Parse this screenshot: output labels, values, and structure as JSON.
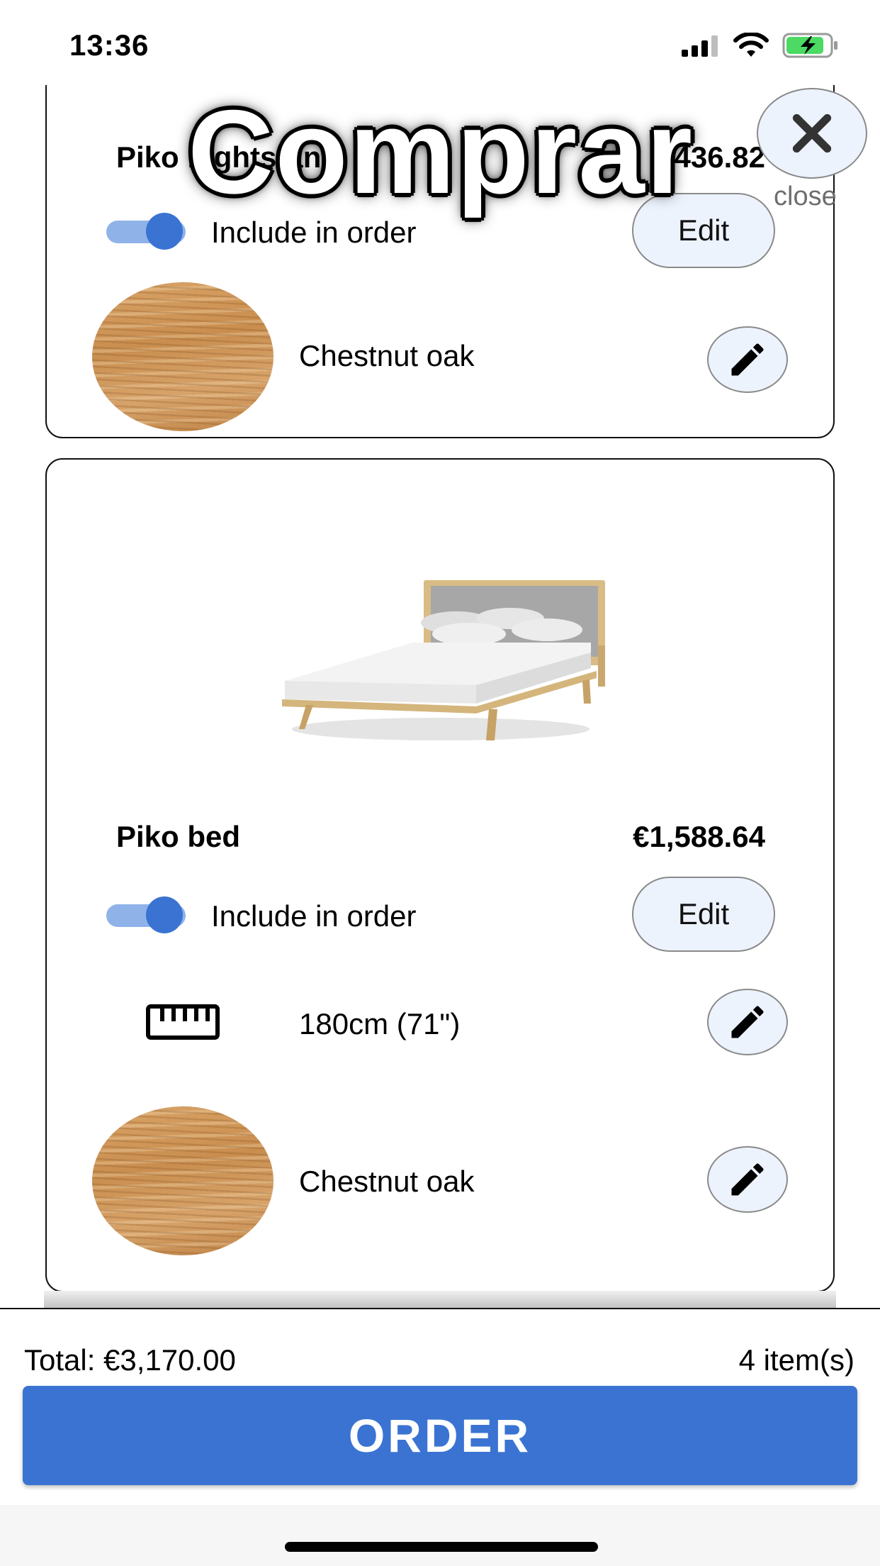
{
  "status_bar": {
    "time": "13:36"
  },
  "overlay": {
    "title": "Comprar",
    "close_label": "close"
  },
  "items": [
    {
      "name": "Piko nightstand",
      "price": "€436.82",
      "include_label": "Include in order",
      "include_checked": true,
      "edit_label": "Edit",
      "options": [
        {
          "type": "material",
          "icon": "wood-swatch",
          "label": "Chestnut oak"
        }
      ]
    },
    {
      "name": "Piko bed",
      "price": "€1,588.64",
      "include_label": "Include in order",
      "include_checked": true,
      "edit_label": "Edit",
      "image": "bed-image",
      "options": [
        {
          "type": "size",
          "icon": "ruler-icon",
          "label": "180cm (71\")"
        },
        {
          "type": "material",
          "icon": "wood-swatch",
          "label": "Chestnut oak"
        }
      ]
    }
  ],
  "footer": {
    "total": "Total: €3,170.00",
    "item_count": "4 item(s)",
    "order_label": "ORDER"
  },
  "colors": {
    "accent": "#3a73d2",
    "toggle_track": "#8fb3e8",
    "button_bg": "#edf3fd"
  }
}
